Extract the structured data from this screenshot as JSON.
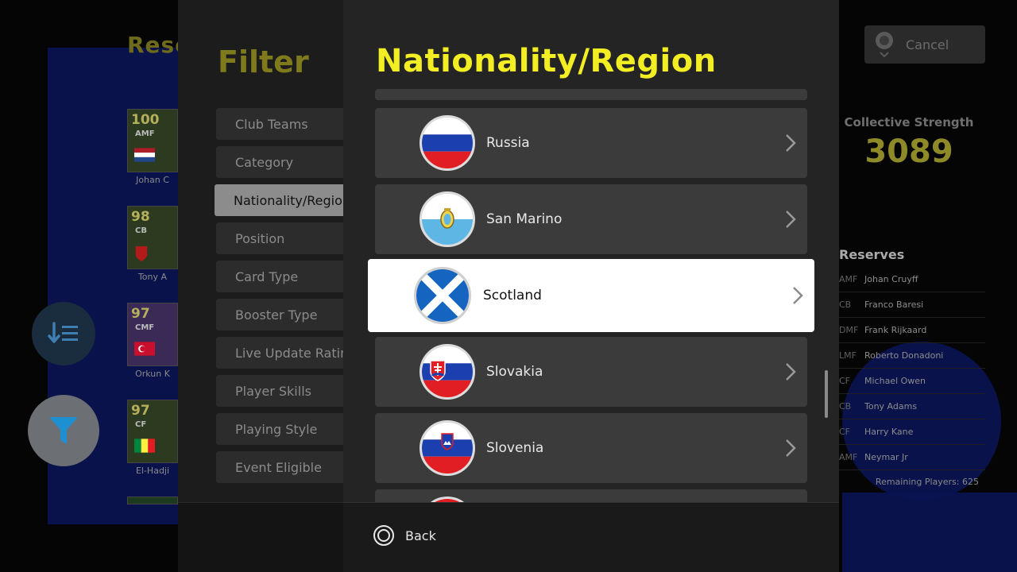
{
  "background": {
    "title": "Rese",
    "cards": [
      {
        "rating": "100",
        "position": "AMF",
        "name": "Johan C",
        "flag": "nl"
      },
      {
        "rating": "98",
        "position": "CB",
        "name": "Tony A",
        "flag": "en"
      },
      {
        "rating": "97",
        "position": "CMF",
        "name": "Orkun K",
        "flag": "tr"
      },
      {
        "rating": "97",
        "position": "CF",
        "name": "El-Hadji",
        "flag": "sn"
      }
    ],
    "cancel_label": "Cancel",
    "collective_strength_label": "Collective Strength",
    "collective_strength_value": "3089",
    "reserves_title": "Reserves",
    "reserves": [
      {
        "pos": "AMF",
        "name": "Johan Cruyff"
      },
      {
        "pos": "CB",
        "name": "Franco Baresi"
      },
      {
        "pos": "DMF",
        "name": "Frank Rijkaard"
      },
      {
        "pos": "LMF",
        "name": "Roberto Donadoni"
      },
      {
        "pos": "CF",
        "name": "Michael Owen"
      },
      {
        "pos": "CB",
        "name": "Tony Adams"
      },
      {
        "pos": "CF",
        "name": "Harry Kane"
      },
      {
        "pos": "AMF",
        "name": "Neymar Jr"
      }
    ],
    "remaining_players": "Remaining Players: 625"
  },
  "filter": {
    "title": "Filter",
    "items": [
      {
        "label": "Club Teams",
        "active": false
      },
      {
        "label": "Category",
        "active": false
      },
      {
        "label": "Nationality/Region",
        "active": true
      },
      {
        "label": "Position",
        "active": false
      },
      {
        "label": "Card Type",
        "active": false
      },
      {
        "label": "Booster Type",
        "active": false
      },
      {
        "label": "Live Update Rating",
        "active": false
      },
      {
        "label": "Player Skills",
        "active": false
      },
      {
        "label": "Playing Style",
        "active": false
      },
      {
        "label": "Event Eligible",
        "active": false
      }
    ]
  },
  "nationality": {
    "title": "Nationality/Region",
    "items": [
      {
        "name": "Russia",
        "flag": "russia-flag-icon",
        "selected": false
      },
      {
        "name": "San Marino",
        "flag": "san-marino-flag-icon",
        "selected": false
      },
      {
        "name": "Scotland",
        "flag": "scotland-flag-icon",
        "selected": true
      },
      {
        "name": "Slovakia",
        "flag": "slovakia-flag-icon",
        "selected": false
      },
      {
        "name": "Slovenia",
        "flag": "slovenia-flag-icon",
        "selected": false
      }
    ],
    "back_label": "Back"
  },
  "colors": {
    "accent_yellow": "#f3ee24",
    "selected_row": "#ffffff",
    "row": "#3b3b3b"
  }
}
